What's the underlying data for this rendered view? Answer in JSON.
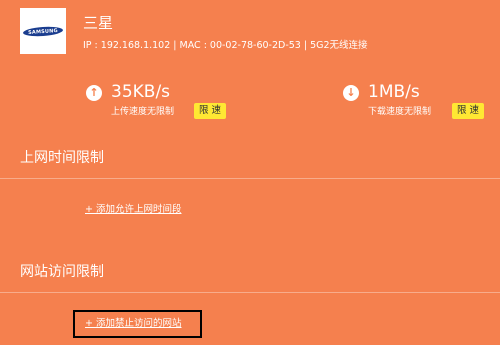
{
  "device": {
    "logo_text": "SAMSUNG",
    "name": "三星",
    "info": "IP : 192.168.1.102 | MAC : 00-02-78-60-2D-53 | 5G2无线连接"
  },
  "upload": {
    "icon": "arrow-up-icon",
    "value": "35KB/s",
    "caption": "上传速度无限制",
    "button_label": "限 速"
  },
  "download": {
    "icon": "arrow-down-icon",
    "value": "1MB/s",
    "caption": "下载速度无限制",
    "button_label": "限 速"
  },
  "time_limit": {
    "title": "上网时间限制",
    "add_link": "+ 添加允许上网时间段"
  },
  "site_limit": {
    "title": "网站访问限制",
    "add_link": "+ 添加禁止访问的网站"
  },
  "colors": {
    "background": "#f5804e",
    "button": "#ffe833",
    "highlight_border": "#000000"
  }
}
